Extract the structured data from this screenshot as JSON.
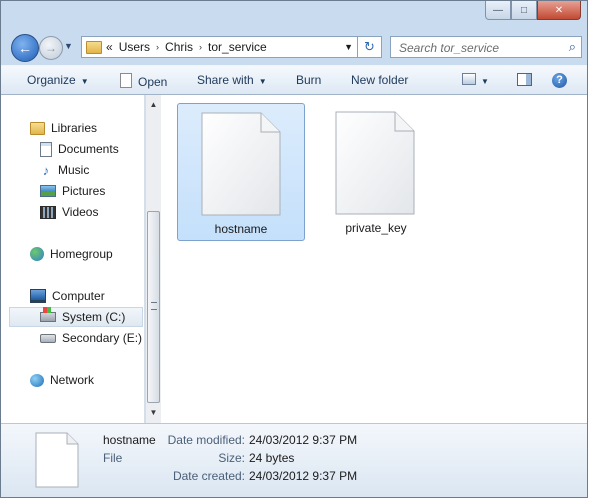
{
  "window": {
    "caption_buttons": {
      "minimize": "—",
      "maximize": "□",
      "close": "✕"
    }
  },
  "address": {
    "prefix": "«",
    "breadcrumb": [
      "Users",
      "Chris",
      "tor_service"
    ],
    "separator": "›",
    "dropdown": "▼",
    "refresh": "↻"
  },
  "search": {
    "placeholder": "Search tor_service",
    "icon": "search-icon"
  },
  "toolbar": {
    "organize": "Organize",
    "open": "Open",
    "share_with": "Share with",
    "burn": "Burn",
    "new_folder": "New folder",
    "arrow": "▼",
    "help": "?"
  },
  "navigation": {
    "libraries": "Libraries",
    "documents": "Documents",
    "music": "Music",
    "pictures": "Pictures",
    "videos": "Videos",
    "homegroup": "Homegroup",
    "computer": "Computer",
    "system_c": "System (C:)",
    "secondary_e": "Secondary (E:)",
    "network": "Network"
  },
  "files": [
    {
      "name": "hostname",
      "selected": true
    },
    {
      "name": "private_key",
      "selected": false
    }
  ],
  "details": {
    "name": "hostname",
    "type": "File",
    "date_modified_label": "Date modified:",
    "date_modified": "24/03/2012 9:37 PM",
    "size_label": "Size:",
    "size": "24 bytes",
    "date_created_label": "Date created:",
    "date_created": "24/03/2012 9:37 PM"
  },
  "scrollbar": {
    "up": "▲",
    "down": "▼",
    "grip": "≡"
  }
}
